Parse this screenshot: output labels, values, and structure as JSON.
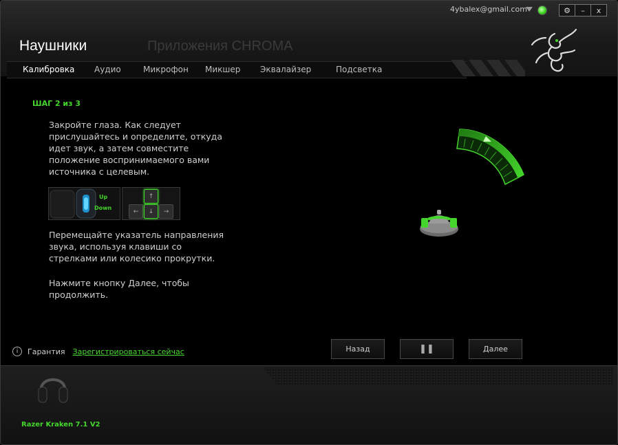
{
  "header": {
    "user_email": "4ybalex@gmail.com",
    "title": "Наушники",
    "chroma_label": "Приложения CHROMA",
    "window_buttons": {
      "settings": "⚙",
      "minimize": "–",
      "close": "x"
    }
  },
  "tabs": [
    {
      "label": "Калибровка",
      "active": true
    },
    {
      "label": "Аудио"
    },
    {
      "label": "Микрофон"
    },
    {
      "label": "Микшер"
    },
    {
      "label": "Эквалайзер"
    },
    {
      "label": "Подсветка"
    }
  ],
  "calibration": {
    "step": "ШАГ 2 из 3",
    "instruction1": "Закройте глаза. Как следует\nприслушайтесь и определите, откуда\nидет звук, а затем совместите\nположение воспринимаемого вами\nисточника с целевым.",
    "instruction2": "Перемещайте указатель направления\nзвука, используя клавиши со\nстрелками или колесико прокрутки.",
    "instruction3": "Нажмите кнопку Далее, чтобы\nпродолжить.",
    "scroll_up": "Up",
    "scroll_down": "Down",
    "keys": {
      "up": "↑",
      "left": "←",
      "down": "↓",
      "right": "→"
    }
  },
  "buttons": {
    "back": "Назад",
    "pause": "❚❚",
    "next": "Далее"
  },
  "footer": {
    "warranty_label": "Гарантия",
    "register_link": "Зарегистрироваться сейчас",
    "device_name": "Razer Kraken 7.1 V2"
  },
  "colors": {
    "accent": "#44d62c",
    "background": "#000000"
  }
}
